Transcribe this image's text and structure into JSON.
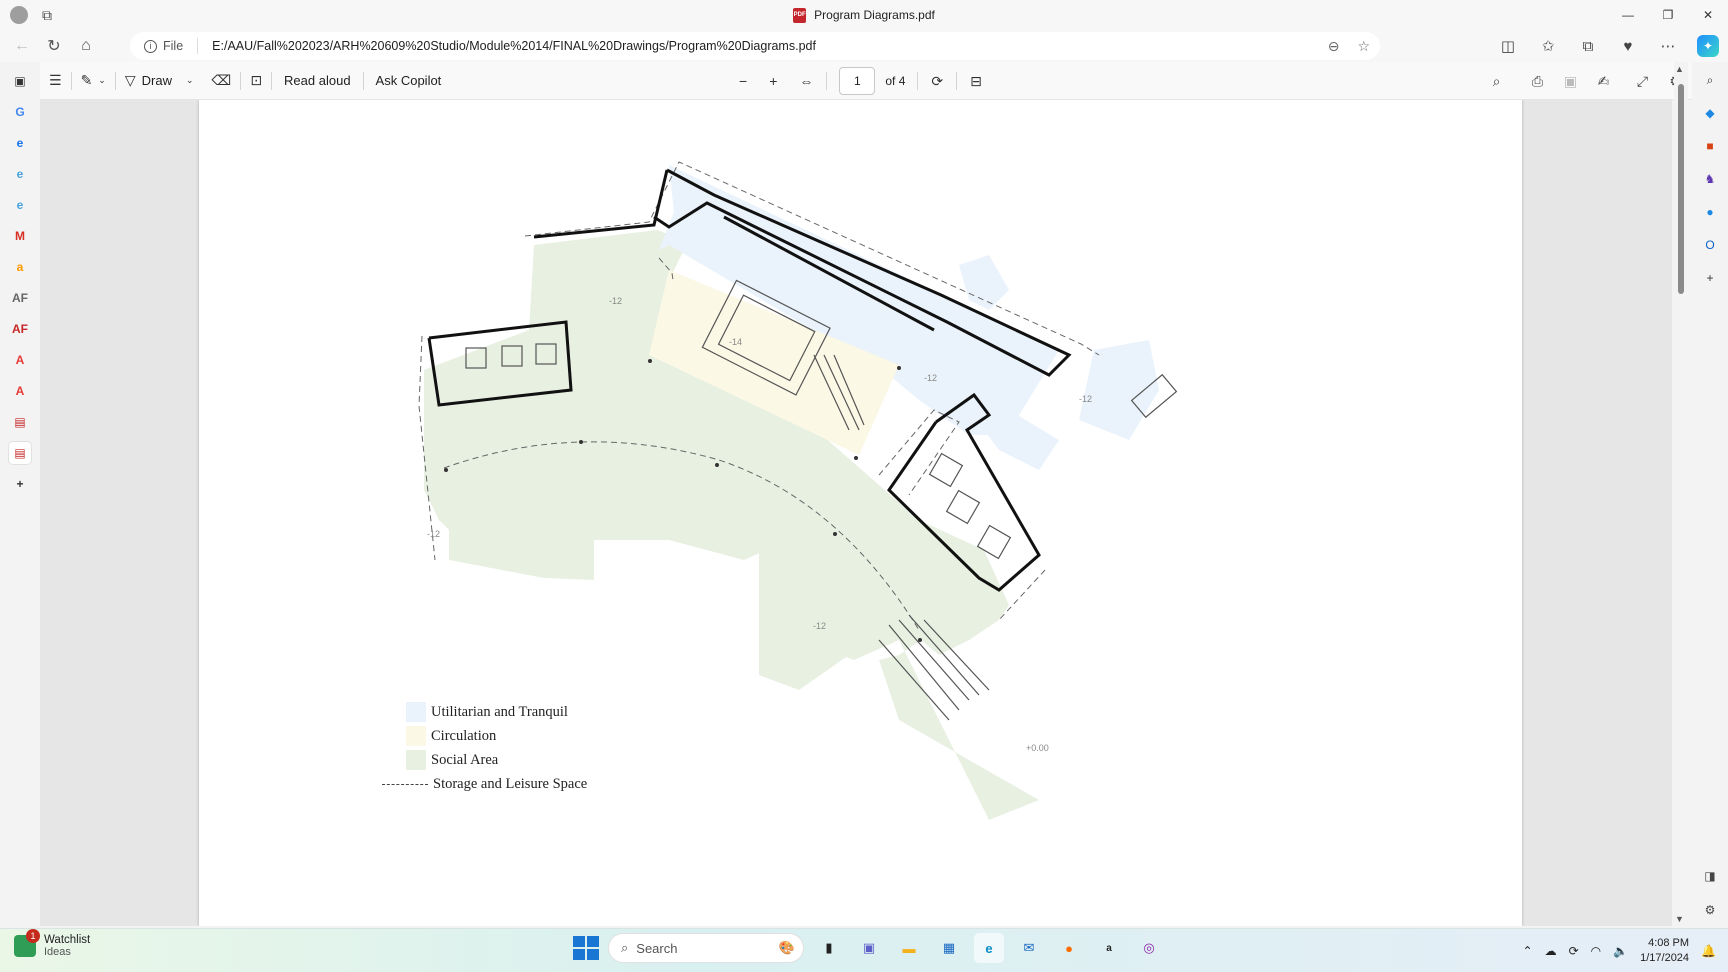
{
  "window": {
    "title": "Program Diagrams.pdf",
    "pdf_badge": "PDF",
    "minimize": "—",
    "restore": "❐",
    "close": "✕"
  },
  "address": {
    "file_label": "File",
    "info_glyph": "i",
    "url": "E:/AAU/Fall%202023/ARH%20609%20Studio/Module%2014/FINAL%20Drawings/Program%20Diagrams.pdf"
  },
  "pdf_toolbar": {
    "draw_label": "Draw",
    "read_aloud_label": "Read aloud",
    "ask_copilot_label": "Ask Copilot",
    "page_current": "1",
    "page_total": "of 4"
  },
  "left_sidebar": [
    {
      "name": "tab-actions-icon",
      "glyph": "▣",
      "color": "#333333"
    },
    {
      "name": "google-icon",
      "glyph": "G",
      "color": "#4285f4"
    },
    {
      "name": "edge-tab-icon-1",
      "glyph": "e",
      "color": "#1a73e8"
    },
    {
      "name": "edge-tab-icon-2",
      "glyph": "e",
      "color": "#4aa3df"
    },
    {
      "name": "edge-tab-icon-3",
      "glyph": "e",
      "color": "#4aa3df"
    },
    {
      "name": "gmail-icon",
      "glyph": "M",
      "color": "#d93025"
    },
    {
      "name": "amazon-icon",
      "glyph": "a",
      "color": "#ff9900"
    },
    {
      "name": "af-icon-1",
      "glyph": "AF",
      "color": "#666666"
    },
    {
      "name": "af-icon-2",
      "glyph": "AF",
      "color": "#c62828"
    },
    {
      "name": "acrobat-icon-1",
      "glyph": "A",
      "color": "#e53935"
    },
    {
      "name": "acrobat-icon-2",
      "glyph": "A",
      "color": "#e53935"
    },
    {
      "name": "pdf-tab-icon-1",
      "glyph": "▤",
      "color": "#c62828"
    },
    {
      "name": "pdf-tab-icon-2",
      "glyph": "▤",
      "color": "#c62828"
    },
    {
      "name": "add-tab-icon",
      "glyph": "+",
      "color": "#333333"
    }
  ],
  "right_sidebar": [
    {
      "name": "search-icon",
      "glyph": "⌕",
      "color": "#333333"
    },
    {
      "name": "shopping-tag-icon",
      "glyph": "◆",
      "color": "#1e88e5"
    },
    {
      "name": "tools-icon",
      "glyph": "■",
      "color": "#d84315"
    },
    {
      "name": "games-icon",
      "glyph": "♞",
      "color": "#5e35b1"
    },
    {
      "name": "microsoft365-icon",
      "glyph": "●",
      "color": "#1e88e5"
    },
    {
      "name": "outlook-icon",
      "glyph": "O",
      "color": "#0a64c8"
    },
    {
      "name": "add-app-icon",
      "glyph": "+",
      "color": "#333333"
    }
  ],
  "legend": [
    {
      "label": "Utilitarian and Tranquil",
      "color": "#eaf3fb"
    },
    {
      "label": "Circulation",
      "color": "#fbf8e6"
    },
    {
      "label": "Social Area",
      "color": "#e8f0e2"
    },
    {
      "label": "Storage and Leisure Space",
      "color": ""
    }
  ],
  "plan_labels": {
    "l1": "-12",
    "l2": "-14",
    "l3": "-12",
    "l4": "-12",
    "l5": "-12",
    "l6": "-12",
    "l7": "+0.00"
  },
  "taskbar": {
    "watchlist_title": "Watchlist",
    "watchlist_sub": "Ideas",
    "watchlist_badge": "1",
    "search_placeholder": "Search",
    "time": "4:08 PM",
    "date": "1/17/2024"
  },
  "colors": {
    "utilitarian": "#eaf3fb",
    "circulation": "#fbf8e6",
    "social": "#e8f0e2",
    "accent": "#1a73e8"
  }
}
